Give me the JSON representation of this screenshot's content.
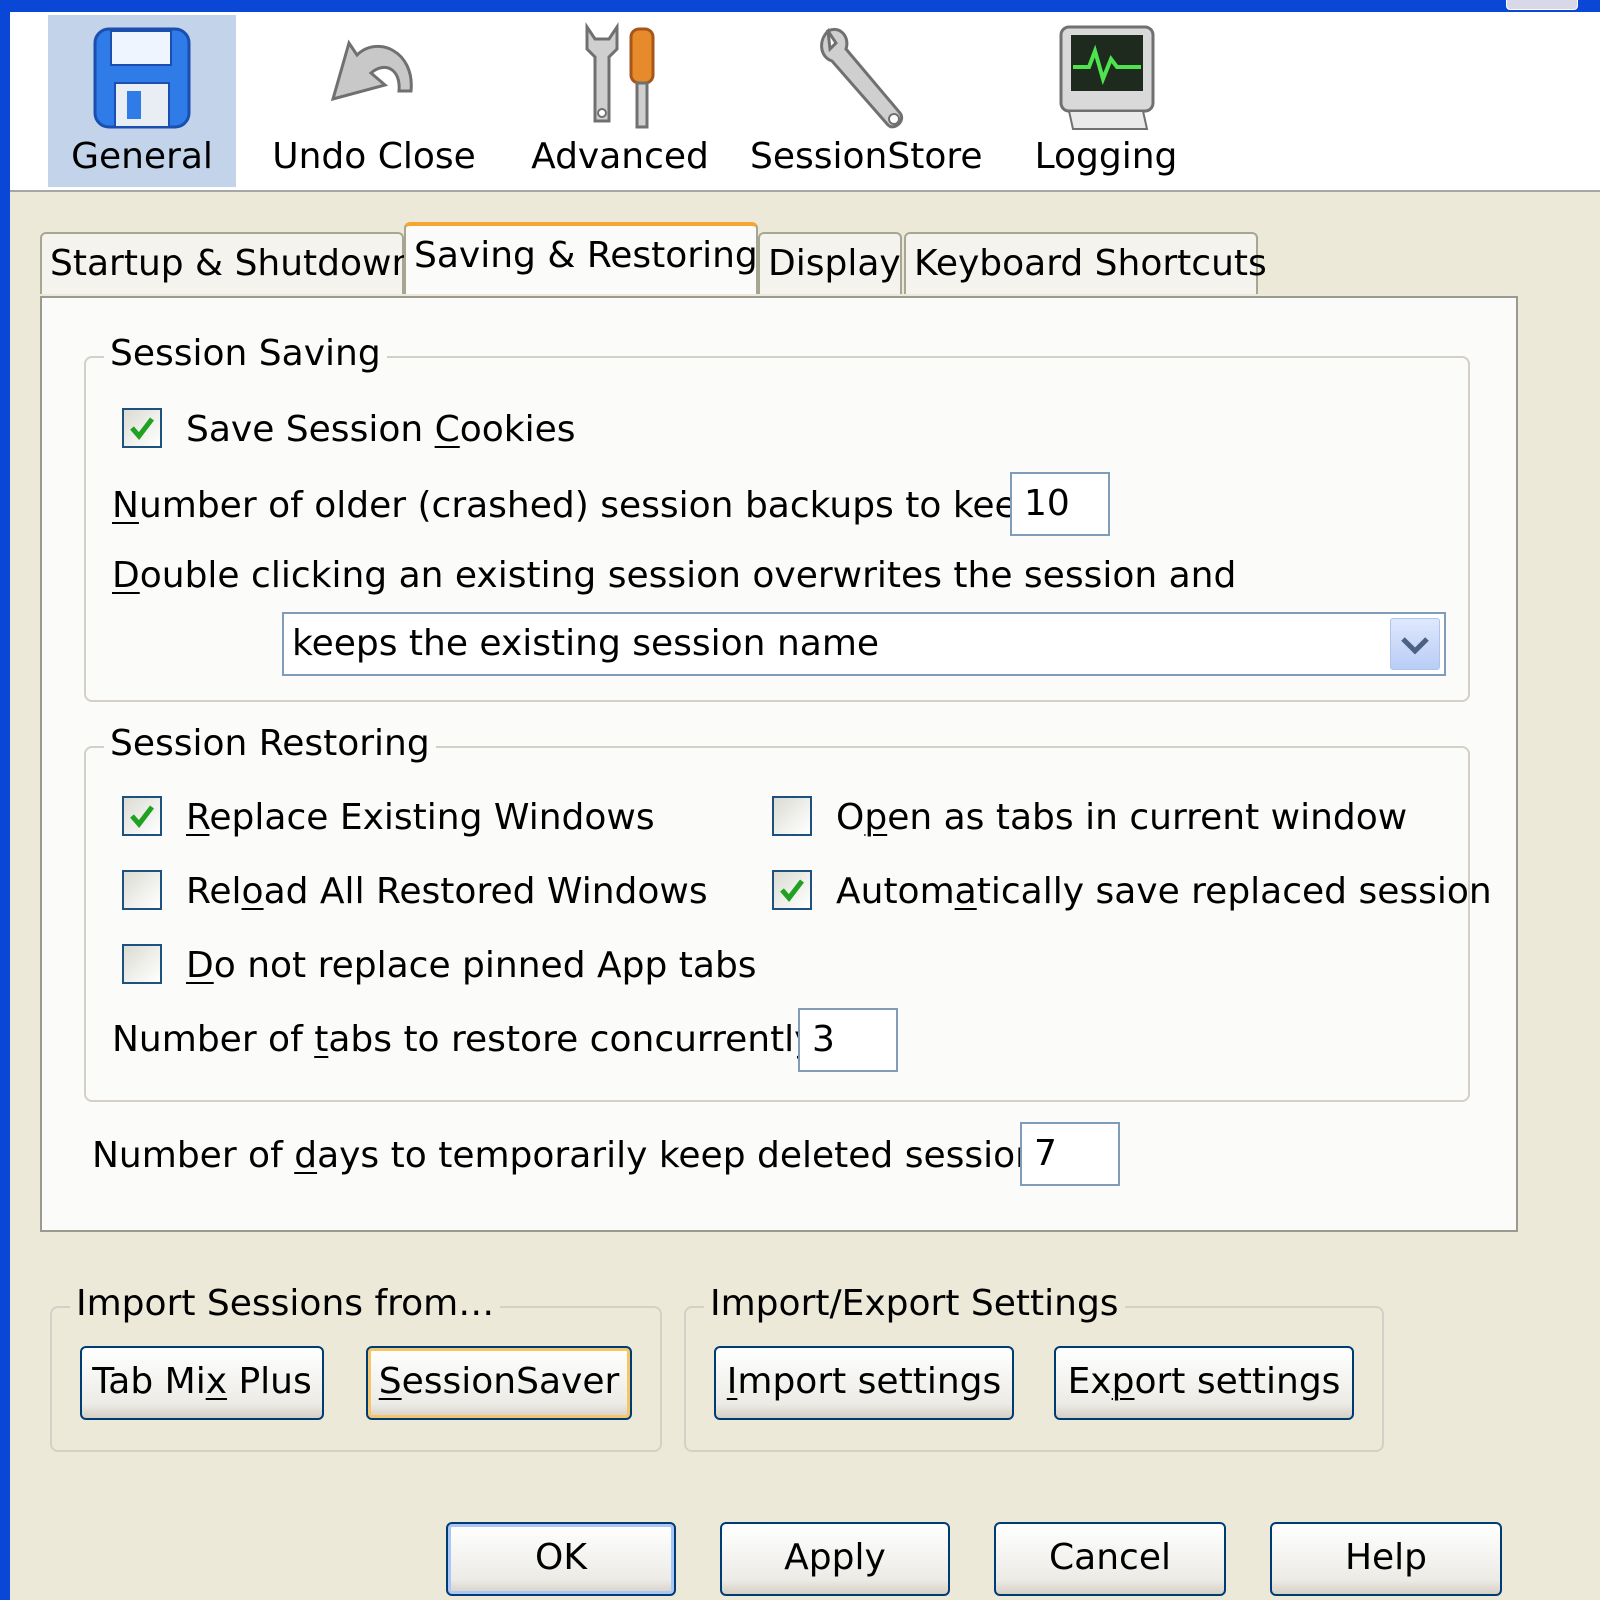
{
  "toolbar": {
    "general": "General",
    "undo_close": "Undo Close",
    "advanced": "Advanced",
    "sessionstore": "SessionStore",
    "logging": "Logging"
  },
  "tabs": {
    "startup": "Startup & Shutdown",
    "saving": "Saving & Restoring",
    "display": "Display",
    "keyboard": "Keyboard Shortcuts"
  },
  "session_saving": {
    "legend": "Session Saving",
    "save_cookies": {
      "pre": "Save Session ",
      "accel": "C",
      "post": "ookies",
      "checked": true
    },
    "backups_label": {
      "accel": "N",
      "post": "umber of older (crashed) session backups to keep:"
    },
    "backups_value": "10",
    "double_click_label": {
      "accel": "D",
      "post": "ouble clicking an existing session overwrites the session and"
    },
    "double_click_selected": "keeps the existing session name"
  },
  "session_restoring": {
    "legend": "Session Restoring",
    "replace_windows": {
      "pre": "",
      "accel": "R",
      "post": "eplace Existing Windows",
      "checked": true
    },
    "reload_windows": {
      "pre": "Rel",
      "accel": "o",
      "post": "ad All Restored Windows",
      "checked": false
    },
    "no_replace_pinned": {
      "pre": "",
      "accel": "D",
      "post": "o not replace pinned App tabs",
      "checked": false
    },
    "open_as_tabs": {
      "pre": "O",
      "accel": "p",
      "post": "en as tabs in current window",
      "checked": false
    },
    "auto_save": {
      "pre": "Autom",
      "accel": "a",
      "post": "tically save replaced session",
      "checked": true
    },
    "concurrent_label": {
      "pre": "Number of ",
      "accel": "t",
      "post": "abs to restore concurrently"
    },
    "concurrent_value": "3"
  },
  "days_label": {
    "pre": "Number of ",
    "accel": "d",
    "post": "ays to temporarily keep deleted sessions:"
  },
  "days_value": "7",
  "import_sessions": {
    "legend": "Import Sessions from…",
    "tab_mix_plus": {
      "pre": "Tab Mi",
      "accel": "x",
      "post": " Plus"
    },
    "session_saver": {
      "pre": "",
      "accel": "S",
      "post": "essionSaver"
    }
  },
  "import_export": {
    "legend": "Import/Export Settings",
    "import": {
      "pre": "",
      "accel": "I",
      "post": "mport settings"
    },
    "export": {
      "pre": "Ex",
      "accel": "p",
      "post": "ort settings"
    }
  },
  "dialog_buttons": {
    "ok": "OK",
    "apply": "Apply",
    "cancel": "Cancel",
    "help": "Help"
  },
  "colors": {
    "title_bar": "#0a47d6",
    "dialog_bg": "#ece9d8",
    "selected_toolbar": "#c3d3ea",
    "active_tab_accent": "#f3a630",
    "check_green": "#21a121"
  }
}
